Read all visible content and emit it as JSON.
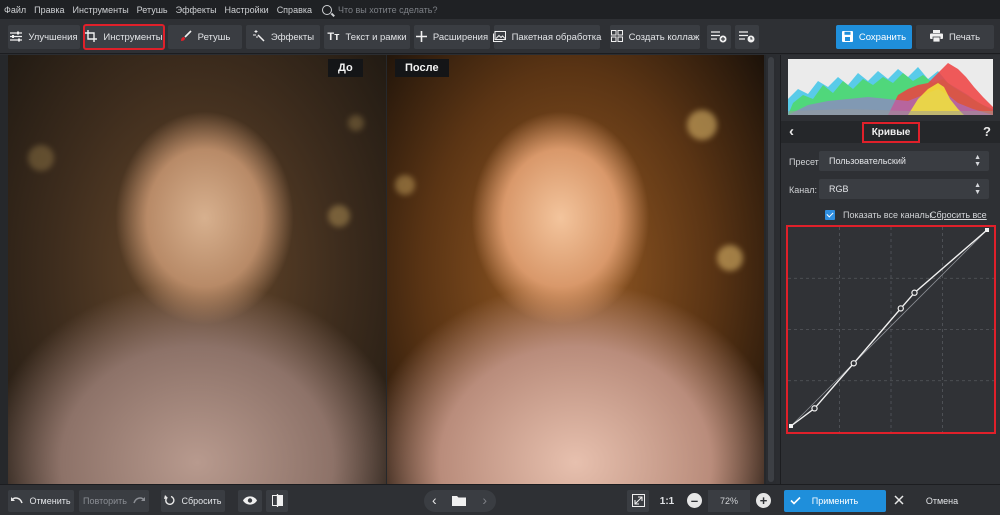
{
  "menu": {
    "items": [
      "Файл",
      "Правка",
      "Инструменты",
      "Ретушь",
      "Эффекты",
      "Настройки",
      "Справка"
    ],
    "search_placeholder": "Что вы хотите сделать?"
  },
  "toolbar": {
    "enhance": "Улучшения",
    "tools": "Инструменты",
    "retouch": "Ретушь",
    "effects": "Эффекты",
    "text": "Текст и рамки",
    "extensions": "Расширения",
    "batch": "Пакетная обработка",
    "collage": "Создать коллаж",
    "save": "Сохранить",
    "print": "Печать",
    "tt_glyph": "Tт"
  },
  "preview": {
    "before_label": "До",
    "after_label": "После"
  },
  "panel": {
    "title": "Кривые",
    "help": "?",
    "preset_label": "Пресет:",
    "preset_value": "Пользовательский",
    "channel_label": "Канал:",
    "channel_value": "RGB",
    "show_all_channels": "Показать все каналы",
    "show_all_checked": true,
    "reset_all": "Сбросить все",
    "curve_points": [
      [
        0,
        0
      ],
      [
        0.12,
        0.09
      ],
      [
        0.32,
        0.32
      ],
      [
        0.56,
        0.6
      ],
      [
        0.63,
        0.68
      ],
      [
        1,
        1
      ]
    ]
  },
  "bottom": {
    "undo": "Отменить",
    "redo": "Повторить",
    "reset": "Сбросить",
    "ratio": "1:1",
    "zoom": "72%",
    "apply": "Применить",
    "cancel": "Отмена"
  },
  "colors": {
    "accent": "#1f8fdb",
    "highlight": "#e0202a"
  }
}
